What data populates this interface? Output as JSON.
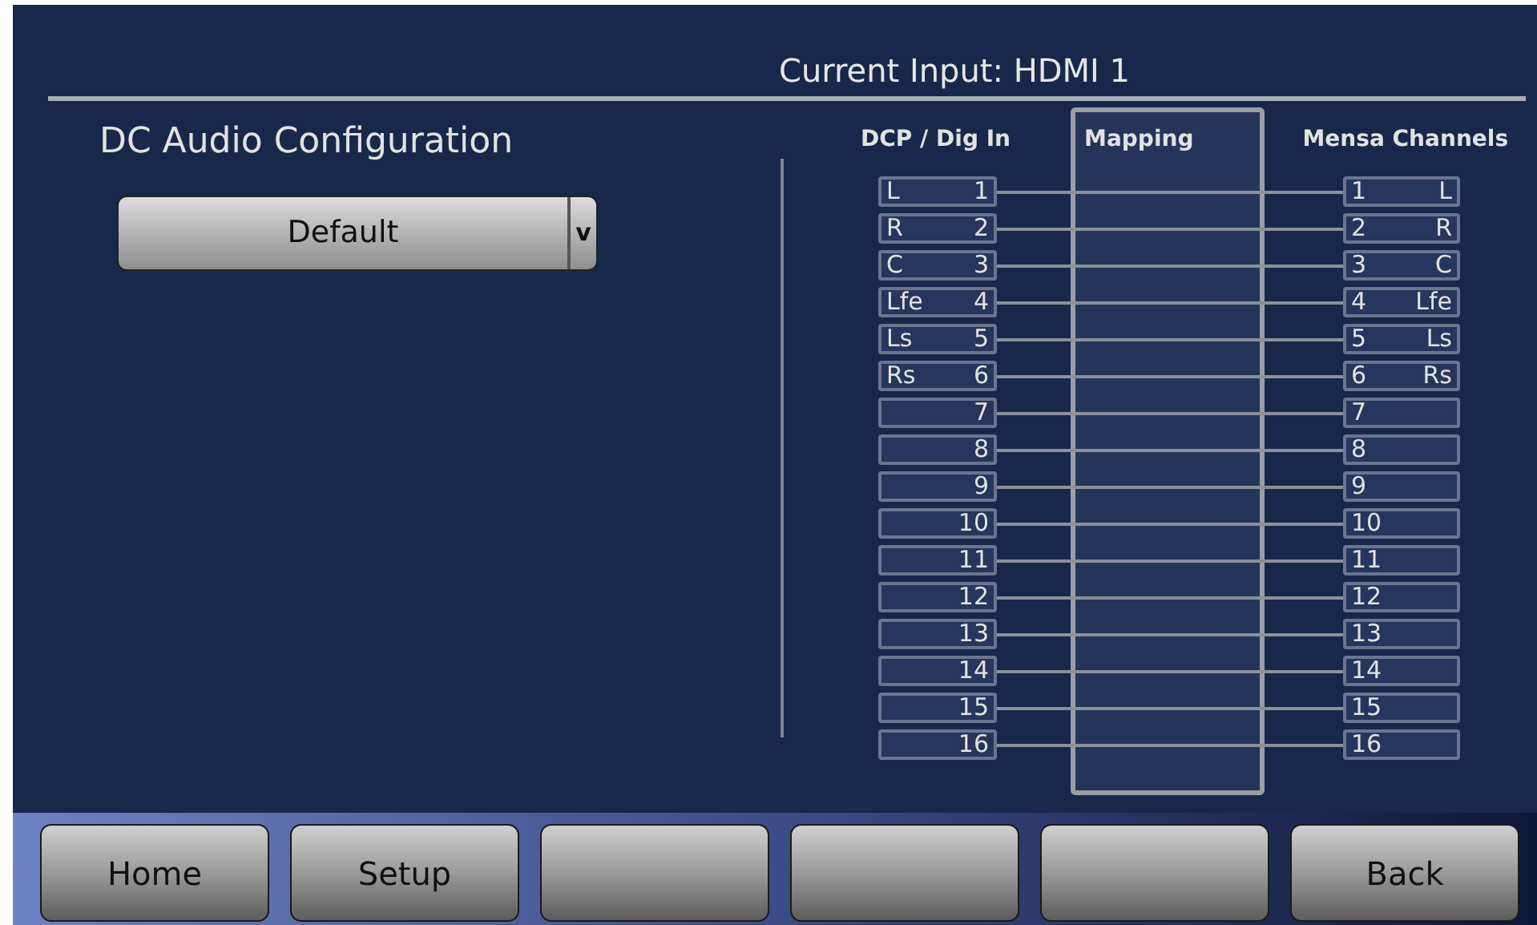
{
  "header": {
    "title": "Current Input: HDMI 1"
  },
  "configuration": {
    "title": "DC Audio Configuration",
    "dropdown": {
      "value": "Default",
      "arrow": "v"
    }
  },
  "mapping": {
    "source_heading": "DCP / Dig In",
    "mapping_heading": "Mapping",
    "output_heading": "Mensa Channels",
    "rows": [
      {
        "source": {
          "name": "L",
          "number": "1"
        },
        "output": {
          "number": "1",
          "name": "L"
        }
      },
      {
        "source": {
          "name": "R",
          "number": "2"
        },
        "output": {
          "number": "2",
          "name": "R"
        }
      },
      {
        "source": {
          "name": "C",
          "number": "3"
        },
        "output": {
          "number": "3",
          "name": "C"
        }
      },
      {
        "source": {
          "name": "Lfe",
          "number": "4"
        },
        "output": {
          "number": "4",
          "name": "Lfe"
        }
      },
      {
        "source": {
          "name": "Ls",
          "number": "5"
        },
        "output": {
          "number": "5",
          "name": "Ls"
        }
      },
      {
        "source": {
          "name": "Rs",
          "number": "6"
        },
        "output": {
          "number": "6",
          "name": "Rs"
        }
      },
      {
        "source": {
          "number": "7"
        },
        "output": {
          "number": "7"
        }
      },
      {
        "source": {
          "number": "8"
        },
        "output": {
          "number": "8"
        }
      },
      {
        "source": {
          "number": "9"
        },
        "output": {
          "number": "9"
        }
      },
      {
        "source": {
          "number": "10"
        },
        "output": {
          "number": "10"
        }
      },
      {
        "source": {
          "number": "11"
        },
        "output": {
          "number": "11"
        }
      },
      {
        "source": {
          "number": "12"
        },
        "output": {
          "number": "12"
        }
      },
      {
        "source": {
          "number": "13"
        },
        "output": {
          "number": "13"
        }
      },
      {
        "source": {
          "number": "14"
        },
        "output": {
          "number": "14"
        }
      },
      {
        "source": {
          "number": "15"
        },
        "output": {
          "number": "15"
        }
      },
      {
        "source": {
          "number": "16"
        },
        "output": {
          "number": "16"
        }
      }
    ]
  },
  "buttons": [
    {
      "kind": "labeled",
      "label": "Home"
    },
    {
      "kind": "labeled",
      "label": "Setup"
    },
    {
      "kind": "blank"
    },
    {
      "kind": "blank"
    },
    {
      "kind": "blank"
    },
    {
      "kind": "labeled",
      "label": "Back"
    }
  ]
}
